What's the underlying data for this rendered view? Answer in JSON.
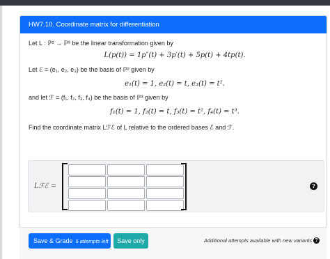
{
  "header": {
    "title": "HW7.10. Coordinate matrix for differentiation"
  },
  "problem": {
    "line1": "Let L : ℙ² → ℙ³ be the linear transformation given by",
    "eq1": "L(p(t)) = 1p″(t) + 3p′(t) + 5p(t) + 4tp(t).",
    "line2": "Let ℰ = (e₁, e₂, e₃) be the basis of ℙ² given by",
    "eq2": "e₁(t) = 1, e₂(t) = t, e₃(t) = t².",
    "line3": "and let ℱ = (f₁, f₂, f₃, f₄) be the basis of ℙ³ given by",
    "eq3": "f₁(t) = 1, f₂(t) = t, f₃(t) = t², f₄(t) = t³.",
    "line4": "Find the coordinate matrix Lℱℰ of L relative to the ordered bases ℰ and ℱ."
  },
  "answer": {
    "label": "Lℱℰ =",
    "rows": 4,
    "cols": 3,
    "help_icon": "question-circle-icon"
  },
  "footer": {
    "grade_label": "Save & Grade",
    "attempts_label": "5 attempts left",
    "save_label": "Save only",
    "note": "Additional attempts available with new variants",
    "note_icon": "question-circle-icon"
  },
  "colors": {
    "primary": "#0d6efd",
    "save": "#20a9a9",
    "topbar": "#343a40"
  }
}
